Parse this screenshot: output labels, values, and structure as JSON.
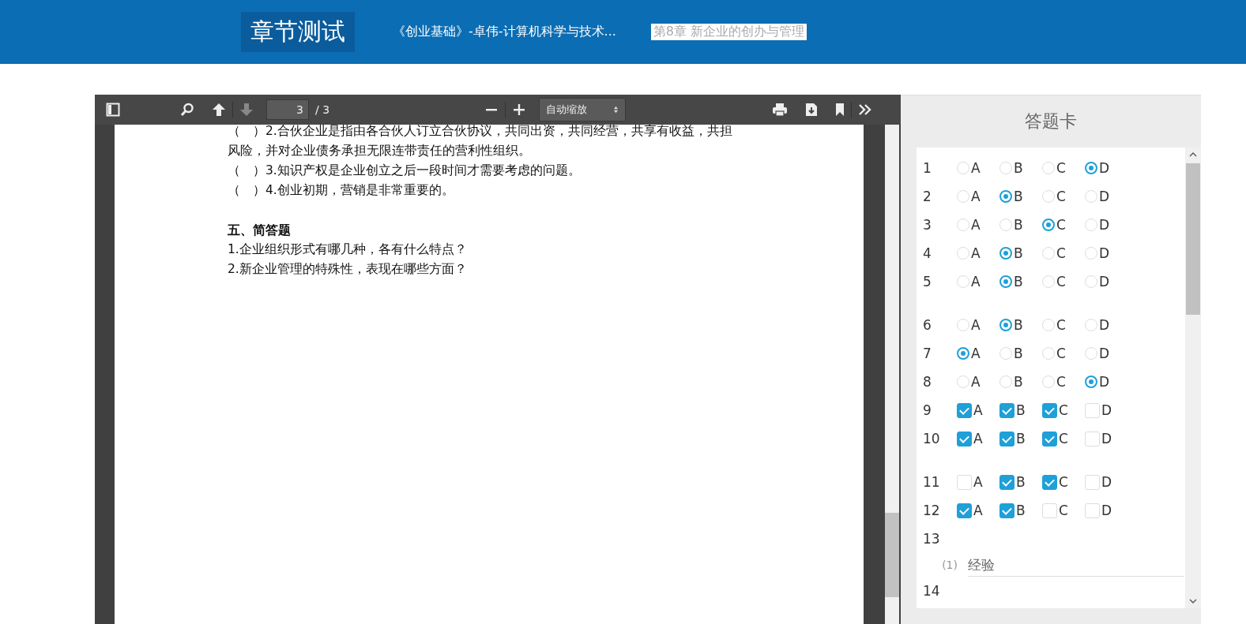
{
  "header": {
    "title": "章节测试",
    "course": "《创业基础》-卓伟-计算机科学与技术...",
    "chapter": "第8章 新企业的创办与管理"
  },
  "viewer": {
    "toolbar": {
      "page": "3",
      "total": "/ 3",
      "zoom": "自动缩放"
    },
    "lines": [
      {
        "kind": "text",
        "text": "（　）2.合伙企业是指由各合伙人订立合伙协议，共同出资，共同经营，共享有收益，共担"
      },
      {
        "kind": "text",
        "text": "风险，并对企业债务承担无限连带责任的营利性组织。"
      },
      {
        "kind": "text",
        "text": "（　）3.知识产权是企业创立之后一段时间才需要考虑的问题。"
      },
      {
        "kind": "text",
        "text": "（　）4.创业初期，营销是非常重要的。"
      },
      {
        "kind": "heading",
        "text": "五、简答题"
      },
      {
        "kind": "text",
        "text": "1.企业组织形式有哪几种，各有什么特点？"
      },
      {
        "kind": "text",
        "text": "2.新企业管理的特殊性，表现在哪些方面？"
      }
    ]
  },
  "answer_card": {
    "title": "答题卡",
    "groups": [
      {
        "questions": [
          {
            "number": "1",
            "kind": "single",
            "options": [
              {
                "label": "A",
                "selected": false
              },
              {
                "label": "B",
                "selected": false
              },
              {
                "label": "C",
                "selected": false
              },
              {
                "label": "D",
                "selected": true
              }
            ]
          },
          {
            "number": "2",
            "kind": "single",
            "options": [
              {
                "label": "A",
                "selected": false
              },
              {
                "label": "B",
                "selected": true
              },
              {
                "label": "C",
                "selected": false
              },
              {
                "label": "D",
                "selected": false
              }
            ]
          },
          {
            "number": "3",
            "kind": "single",
            "options": [
              {
                "label": "A",
                "selected": false
              },
              {
                "label": "B",
                "selected": false
              },
              {
                "label": "C",
                "selected": true
              },
              {
                "label": "D",
                "selected": false
              }
            ]
          },
          {
            "number": "4",
            "kind": "single",
            "options": [
              {
                "label": "A",
                "selected": false
              },
              {
                "label": "B",
                "selected": true
              },
              {
                "label": "C",
                "selected": false
              },
              {
                "label": "D",
                "selected": false
              }
            ]
          },
          {
            "number": "5",
            "kind": "single",
            "options": [
              {
                "label": "A",
                "selected": false
              },
              {
                "label": "B",
                "selected": true
              },
              {
                "label": "C",
                "selected": false
              },
              {
                "label": "D",
                "selected": false
              }
            ]
          }
        ]
      },
      {
        "questions": [
          {
            "number": "6",
            "kind": "single",
            "options": [
              {
                "label": "A",
                "selected": false
              },
              {
                "label": "B",
                "selected": true
              },
              {
                "label": "C",
                "selected": false
              },
              {
                "label": "D",
                "selected": false
              }
            ]
          },
          {
            "number": "7",
            "kind": "single",
            "options": [
              {
                "label": "A",
                "selected": true
              },
              {
                "label": "B",
                "selected": false
              },
              {
                "label": "C",
                "selected": false
              },
              {
                "label": "D",
                "selected": false
              }
            ]
          },
          {
            "number": "8",
            "kind": "single",
            "options": [
              {
                "label": "A",
                "selected": false
              },
              {
                "label": "B",
                "selected": false
              },
              {
                "label": "C",
                "selected": false
              },
              {
                "label": "D",
                "selected": true
              }
            ]
          },
          {
            "number": "9",
            "kind": "multi",
            "options": [
              {
                "label": "A",
                "checked": true
              },
              {
                "label": "B",
                "checked": true
              },
              {
                "label": "C",
                "checked": true
              },
              {
                "label": "D",
                "checked": false
              }
            ]
          },
          {
            "number": "10",
            "kind": "multi",
            "options": [
              {
                "label": "A",
                "checked": true
              },
              {
                "label": "B",
                "checked": true
              },
              {
                "label": "C",
                "checked": true
              },
              {
                "label": "D",
                "checked": false
              }
            ]
          }
        ]
      },
      {
        "questions": [
          {
            "number": "11",
            "kind": "multi",
            "options": [
              {
                "label": "A",
                "checked": false
              },
              {
                "label": "B",
                "checked": true
              },
              {
                "label": "C",
                "checked": true
              },
              {
                "label": "D",
                "checked": false
              }
            ]
          },
          {
            "number": "12",
            "kind": "multi",
            "options": [
              {
                "label": "A",
                "checked": true
              },
              {
                "label": "B",
                "checked": true
              },
              {
                "label": "C",
                "checked": false
              },
              {
                "label": "D",
                "checked": false
              }
            ]
          },
          {
            "number": "13",
            "kind": "blank",
            "blanks": [
              {
                "index": "(1)",
                "value": "经验"
              }
            ]
          },
          {
            "number": "14",
            "kind": "blank"
          }
        ]
      }
    ]
  }
}
